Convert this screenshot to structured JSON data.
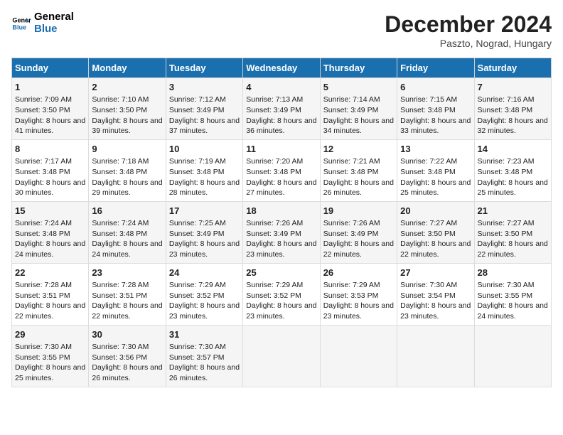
{
  "logo": {
    "line1": "General",
    "line2": "Blue"
  },
  "title": "December 2024",
  "subtitle": "Paszto, Nograd, Hungary",
  "days_header": [
    "Sunday",
    "Monday",
    "Tuesday",
    "Wednesday",
    "Thursday",
    "Friday",
    "Saturday"
  ],
  "weeks": [
    [
      {
        "day": "1",
        "sunrise": "Sunrise: 7:09 AM",
        "sunset": "Sunset: 3:50 PM",
        "daylight": "Daylight: 8 hours and 41 minutes."
      },
      {
        "day": "2",
        "sunrise": "Sunrise: 7:10 AM",
        "sunset": "Sunset: 3:50 PM",
        "daylight": "Daylight: 8 hours and 39 minutes."
      },
      {
        "day": "3",
        "sunrise": "Sunrise: 7:12 AM",
        "sunset": "Sunset: 3:49 PM",
        "daylight": "Daylight: 8 hours and 37 minutes."
      },
      {
        "day": "4",
        "sunrise": "Sunrise: 7:13 AM",
        "sunset": "Sunset: 3:49 PM",
        "daylight": "Daylight: 8 hours and 36 minutes."
      },
      {
        "day": "5",
        "sunrise": "Sunrise: 7:14 AM",
        "sunset": "Sunset: 3:49 PM",
        "daylight": "Daylight: 8 hours and 34 minutes."
      },
      {
        "day": "6",
        "sunrise": "Sunrise: 7:15 AM",
        "sunset": "Sunset: 3:48 PM",
        "daylight": "Daylight: 8 hours and 33 minutes."
      },
      {
        "day": "7",
        "sunrise": "Sunrise: 7:16 AM",
        "sunset": "Sunset: 3:48 PM",
        "daylight": "Daylight: 8 hours and 32 minutes."
      }
    ],
    [
      {
        "day": "8",
        "sunrise": "Sunrise: 7:17 AM",
        "sunset": "Sunset: 3:48 PM",
        "daylight": "Daylight: 8 hours and 30 minutes."
      },
      {
        "day": "9",
        "sunrise": "Sunrise: 7:18 AM",
        "sunset": "Sunset: 3:48 PM",
        "daylight": "Daylight: 8 hours and 29 minutes."
      },
      {
        "day": "10",
        "sunrise": "Sunrise: 7:19 AM",
        "sunset": "Sunset: 3:48 PM",
        "daylight": "Daylight: 8 hours and 28 minutes."
      },
      {
        "day": "11",
        "sunrise": "Sunrise: 7:20 AM",
        "sunset": "Sunset: 3:48 PM",
        "daylight": "Daylight: 8 hours and 27 minutes."
      },
      {
        "day": "12",
        "sunrise": "Sunrise: 7:21 AM",
        "sunset": "Sunset: 3:48 PM",
        "daylight": "Daylight: 8 hours and 26 minutes."
      },
      {
        "day": "13",
        "sunrise": "Sunrise: 7:22 AM",
        "sunset": "Sunset: 3:48 PM",
        "daylight": "Daylight: 8 hours and 25 minutes."
      },
      {
        "day": "14",
        "sunrise": "Sunrise: 7:23 AM",
        "sunset": "Sunset: 3:48 PM",
        "daylight": "Daylight: 8 hours and 25 minutes."
      }
    ],
    [
      {
        "day": "15",
        "sunrise": "Sunrise: 7:24 AM",
        "sunset": "Sunset: 3:48 PM",
        "daylight": "Daylight: 8 hours and 24 minutes."
      },
      {
        "day": "16",
        "sunrise": "Sunrise: 7:24 AM",
        "sunset": "Sunset: 3:48 PM",
        "daylight": "Daylight: 8 hours and 24 minutes."
      },
      {
        "day": "17",
        "sunrise": "Sunrise: 7:25 AM",
        "sunset": "Sunset: 3:49 PM",
        "daylight": "Daylight: 8 hours and 23 minutes."
      },
      {
        "day": "18",
        "sunrise": "Sunrise: 7:26 AM",
        "sunset": "Sunset: 3:49 PM",
        "daylight": "Daylight: 8 hours and 23 minutes."
      },
      {
        "day": "19",
        "sunrise": "Sunrise: 7:26 AM",
        "sunset": "Sunset: 3:49 PM",
        "daylight": "Daylight: 8 hours and 22 minutes."
      },
      {
        "day": "20",
        "sunrise": "Sunrise: 7:27 AM",
        "sunset": "Sunset: 3:50 PM",
        "daylight": "Daylight: 8 hours and 22 minutes."
      },
      {
        "day": "21",
        "sunrise": "Sunrise: 7:27 AM",
        "sunset": "Sunset: 3:50 PM",
        "daylight": "Daylight: 8 hours and 22 minutes."
      }
    ],
    [
      {
        "day": "22",
        "sunrise": "Sunrise: 7:28 AM",
        "sunset": "Sunset: 3:51 PM",
        "daylight": "Daylight: 8 hours and 22 minutes."
      },
      {
        "day": "23",
        "sunrise": "Sunrise: 7:28 AM",
        "sunset": "Sunset: 3:51 PM",
        "daylight": "Daylight: 8 hours and 22 minutes."
      },
      {
        "day": "24",
        "sunrise": "Sunrise: 7:29 AM",
        "sunset": "Sunset: 3:52 PM",
        "daylight": "Daylight: 8 hours and 23 minutes."
      },
      {
        "day": "25",
        "sunrise": "Sunrise: 7:29 AM",
        "sunset": "Sunset: 3:52 PM",
        "daylight": "Daylight: 8 hours and 23 minutes."
      },
      {
        "day": "26",
        "sunrise": "Sunrise: 7:29 AM",
        "sunset": "Sunset: 3:53 PM",
        "daylight": "Daylight: 8 hours and 23 minutes."
      },
      {
        "day": "27",
        "sunrise": "Sunrise: 7:30 AM",
        "sunset": "Sunset: 3:54 PM",
        "daylight": "Daylight: 8 hours and 23 minutes."
      },
      {
        "day": "28",
        "sunrise": "Sunrise: 7:30 AM",
        "sunset": "Sunset: 3:55 PM",
        "daylight": "Daylight: 8 hours and 24 minutes."
      }
    ],
    [
      {
        "day": "29",
        "sunrise": "Sunrise: 7:30 AM",
        "sunset": "Sunset: 3:55 PM",
        "daylight": "Daylight: 8 hours and 25 minutes."
      },
      {
        "day": "30",
        "sunrise": "Sunrise: 7:30 AM",
        "sunset": "Sunset: 3:56 PM",
        "daylight": "Daylight: 8 hours and 26 minutes."
      },
      {
        "day": "31",
        "sunrise": "Sunrise: 7:30 AM",
        "sunset": "Sunset: 3:57 PM",
        "daylight": "Daylight: 8 hours and 26 minutes."
      },
      null,
      null,
      null,
      null
    ]
  ]
}
